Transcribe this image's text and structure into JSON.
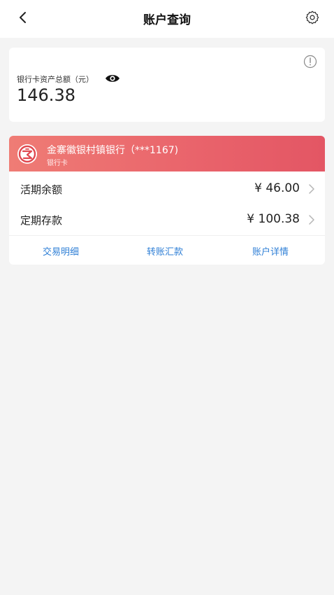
{
  "header": {
    "title": "账户查询",
    "back_icon": "chevron-left-icon",
    "settings_icon": "gear-icon"
  },
  "assets": {
    "label": "银行卡资产总额（元）",
    "amount": "146.38",
    "eye_icon": "eye-icon",
    "info_icon": "info-icon"
  },
  "bank": {
    "name": "金寨徽银村镇银行（***1167)",
    "card_type": "银行卡",
    "logo_icon": "bank-logo-icon",
    "colors": {
      "gradient_start": "#ef7c75",
      "gradient_end": "#e35664"
    }
  },
  "balances": [
    {
      "label": "活期余额",
      "value": "¥ 46.00"
    },
    {
      "label": "定期存款",
      "value": "¥ 100.38"
    }
  ],
  "actions": [
    {
      "label": "交易明细"
    },
    {
      "label": "转账汇款"
    },
    {
      "label": "账户详情"
    }
  ],
  "colors": {
    "action_link": "#2f7fd6",
    "background": "#f4f4f4"
  }
}
